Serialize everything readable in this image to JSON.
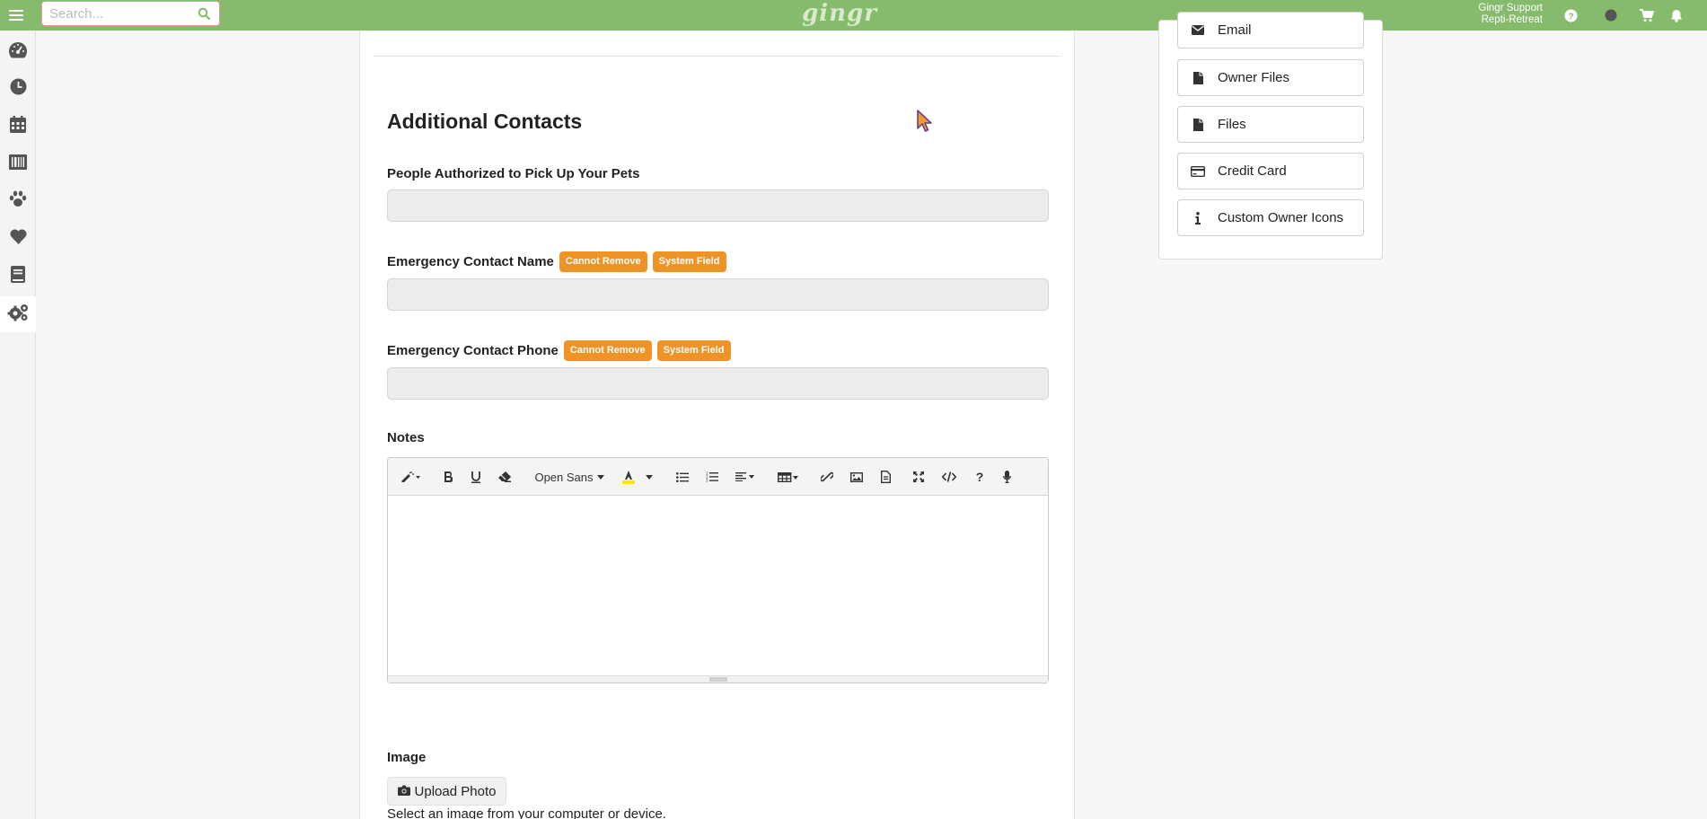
{
  "topbar": {
    "search_placeholder": "Search...",
    "logo_text": "gingr",
    "user_name": "Gingr Support",
    "user_location": "Repti-Retreat"
  },
  "sidebar": {
    "items": [
      {
        "icon": "dashboard-icon"
      },
      {
        "icon": "clock-icon"
      },
      {
        "icon": "calendar-icon"
      },
      {
        "icon": "barcode-icon"
      },
      {
        "icon": "paw-icon"
      },
      {
        "icon": "heart-icon"
      },
      {
        "icon": "book-icon"
      },
      {
        "icon": "gears-icon",
        "active": true
      }
    ]
  },
  "main": {
    "section_title": "Additional Contacts",
    "fields": [
      {
        "label": "People Authorized to Pick Up Your Pets",
        "badges": [],
        "value": ""
      },
      {
        "label": "Emergency Contact Name",
        "badges": [
          "Cannot Remove",
          "System Field"
        ],
        "value": ""
      },
      {
        "label": "Emergency Contact Phone",
        "badges": [
          "Cannot Remove",
          "System Field"
        ],
        "value": ""
      }
    ],
    "notes_label": "Notes",
    "editor": {
      "font_name": "Open Sans",
      "help_label": "?",
      "content": ""
    },
    "image_label": "Image",
    "upload_button": "Upload Photo",
    "upload_help": "Select an image from your computer or device."
  },
  "right_card": {
    "buttons": [
      {
        "label": "Email",
        "icon": "envelope-icon"
      },
      {
        "label": "Owner Files",
        "icon": "file-icon"
      },
      {
        "label": "Files",
        "icon": "file-icon"
      },
      {
        "label": "Credit Card",
        "icon": "credit-card-icon"
      },
      {
        "label": "Custom Owner Icons",
        "icon": "info-icon"
      }
    ]
  },
  "colors": {
    "topbar": "#86bb6d",
    "badge": "#ef9327",
    "logo": "#d7ebc9"
  }
}
